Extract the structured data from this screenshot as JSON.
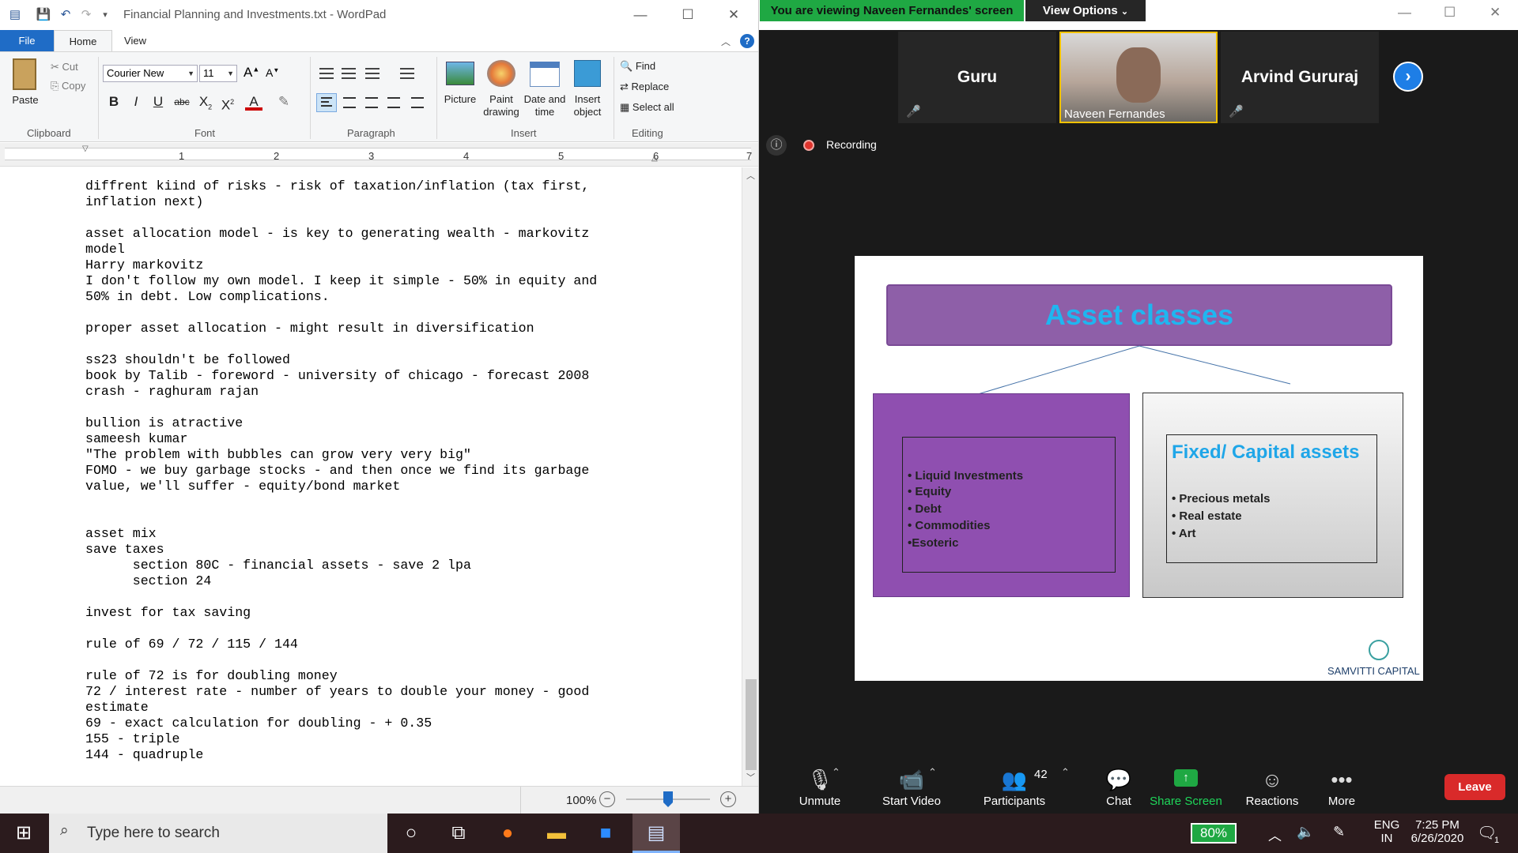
{
  "wordpad": {
    "title": "Financial Planning and Investments.txt - WordPad",
    "tabs": [
      "File",
      "Home",
      "View"
    ],
    "clipboard": {
      "paste": "Paste",
      "cut": "Cut",
      "copy": "Copy",
      "group": "Clipboard"
    },
    "font": {
      "family": "Courier New",
      "size": "11",
      "group": "Font"
    },
    "paragraph": {
      "group": "Paragraph"
    },
    "insert": {
      "picture": "Picture",
      "paint_drawing": "Paint\ndrawing",
      "date_time": "Date and\ntime",
      "insert_object": "Insert\nobject",
      "group": "Insert"
    },
    "editing": {
      "find": "Find",
      "replace": "Replace",
      "select_all": "Select all",
      "group": "Editing"
    },
    "ruler": [
      "1",
      "2",
      "3",
      "4",
      "5",
      "6",
      "7"
    ],
    "lines": [
      "diffrent kiind of risks - risk of taxation/inflation (tax first,",
      "inflation next)",
      "",
      "asset allocation model - is key to generating wealth - markovitz",
      "model",
      "Harry markovitz",
      "I don't follow my own model. I keep it simple - 50% in equity and",
      "50% in debt. Low complications.",
      "",
      "proper asset allocation - might result in diversification",
      "",
      "ss23 shouldn't be followed",
      "book by Talib - foreword - university of chicago - forecast 2008",
      "crash - raghuram rajan",
      "",
      "bullion is atractive",
      "sameesh kumar",
      "\"The problem with bubbles can grow very very big\"",
      "FOMO - we buy garbage stocks - and then once we find its garbage",
      "value, we'll suffer - equity/bond market",
      "",
      "",
      "asset mix",
      "save taxes",
      "      section 80C - financial assets - save 2 lpa",
      "      section 24",
      "",
      "invest for tax saving",
      "",
      "rule of 69 / 72 / 115 / 144",
      "",
      "rule of 72 is for doubling money",
      "72 / interest rate - number of years to double your money - good",
      "estimate",
      "69 - exact calculation for doubling - + 0.35",
      "155 - triple",
      "144 - quadruple"
    ],
    "zoom": "100%"
  },
  "zoom": {
    "banner": "You are viewing Naveen Fernandes' screen",
    "view_options": "View Options",
    "participants": [
      "Guru",
      "Naveen Fernandes",
      "Arvind Gururaj"
    ],
    "recording": "Recording",
    "slide": {
      "title": "Asset classes",
      "left_items": [
        "• Liquid Investments",
        "• Equity",
        "• Debt",
        "• Commodities",
        "•Esoteric"
      ],
      "right_title": "Fixed/ Capital assets",
      "right_items": [
        "• Precious metals",
        "• Real estate",
        "• Art"
      ],
      "logo": "SAMVITTI CAPITAL"
    },
    "toolbar": {
      "unmute": "Unmute",
      "start_video": "Start Video",
      "participants": "Participants",
      "participant_count": "42",
      "chat": "Chat",
      "share_screen": "Share Screen",
      "reactions": "Reactions",
      "more": "More",
      "leave": "Leave"
    }
  },
  "taskbar": {
    "search_placeholder": "Type here to search",
    "battery": "80%",
    "lang_top": "ENG",
    "lang_bottom": "IN",
    "time": "7:25 PM",
    "date": "6/26/2020",
    "notifications": "1"
  }
}
